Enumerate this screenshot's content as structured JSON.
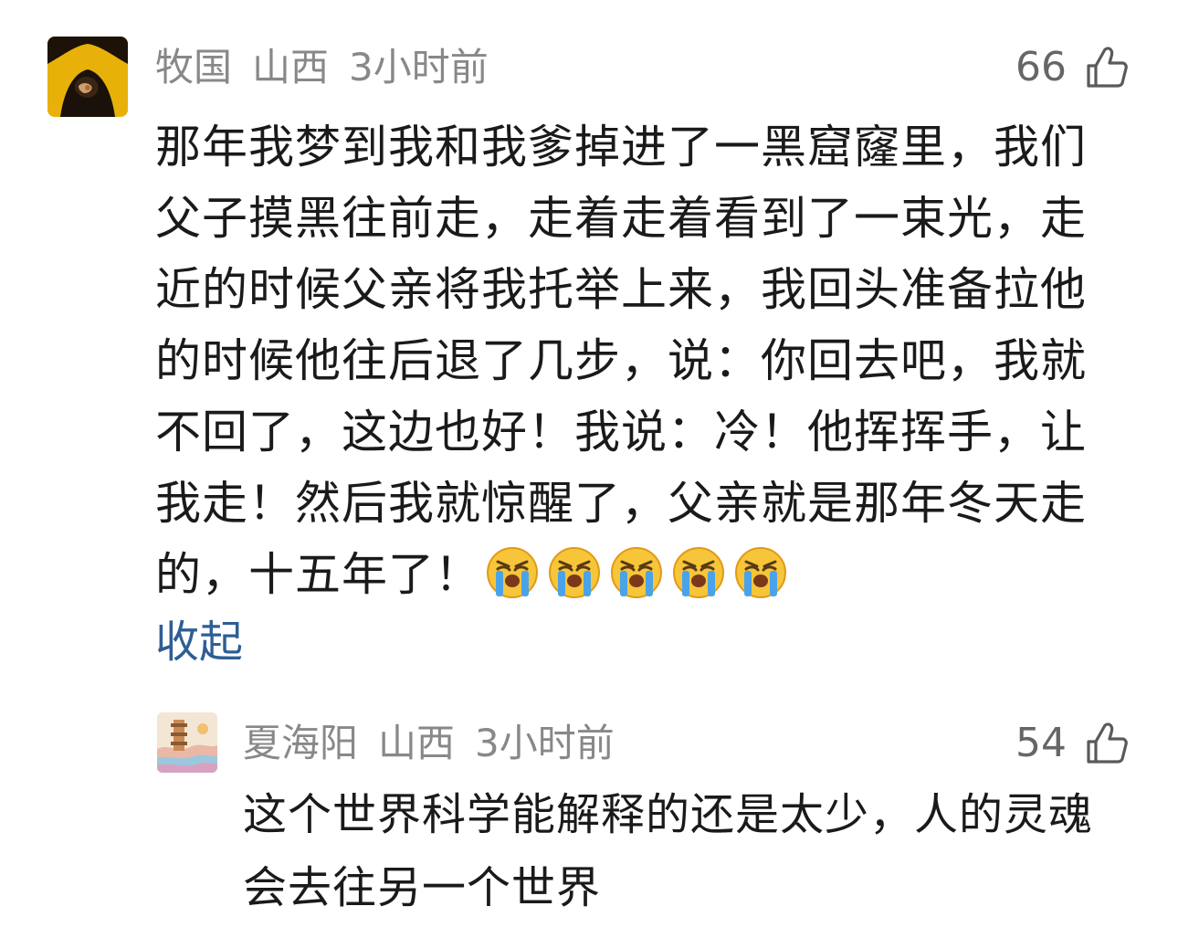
{
  "comment": {
    "username": "牧国",
    "location": "山西",
    "time": "3小时前",
    "like_count": "66",
    "text": "那年我梦到我和我爹掉进了一黑窟窿里，我们父子摸黑往前走，走着走着看到了一束光，走近的时候父亲将我托举上来，我回头准备拉他的时候他往后退了几步，说：你回去吧，我就不回了，这边也好！我说：冷！他挥挥手，让我走！然后我就惊醒了，父亲就是那年冬天走的，十五年了！",
    "emojis": [
      "crying-face",
      "crying-face",
      "crying-face",
      "crying-face",
      "crying-face"
    ],
    "collapse_label": "收起"
  },
  "reply": {
    "username": "夏海阳",
    "location": "山西",
    "time": "3小时前",
    "like_count": "54",
    "text": "这个世界科学能解释的还是太少，人的灵魂会去往另一个世界"
  },
  "icons": {
    "like": "thumbs-up-outline-icon",
    "emoji": "loudly-crying-face"
  },
  "colors": {
    "meta_text": "#888888",
    "body_text": "#1a1a1a",
    "link": "#2f5d95",
    "like_count": "#666666"
  }
}
